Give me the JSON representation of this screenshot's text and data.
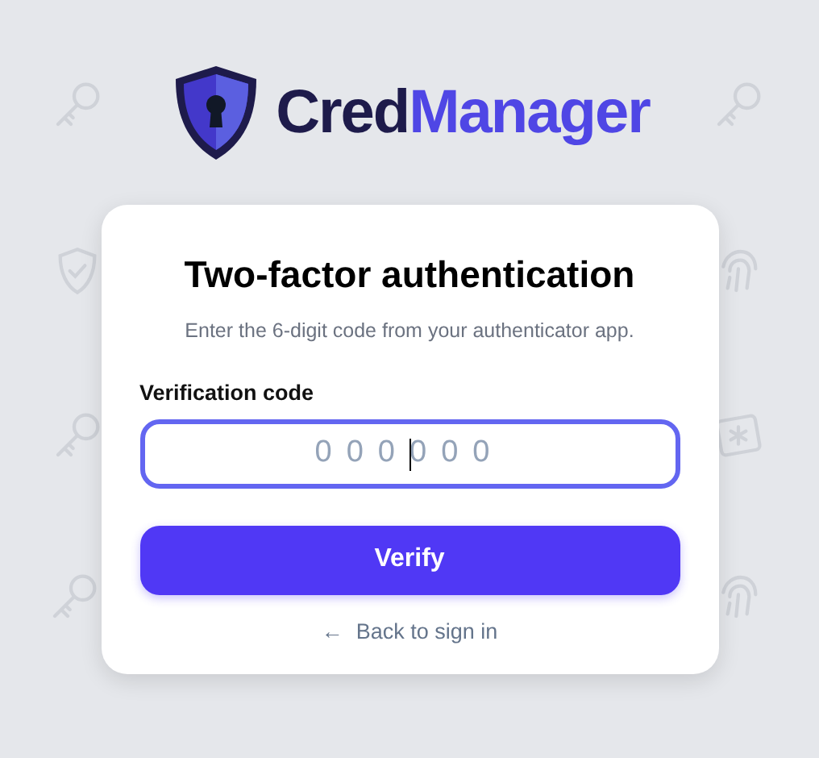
{
  "brand": {
    "name_part_1": "Cred",
    "name_part_2": "Manager"
  },
  "card": {
    "title": "Two-factor authentication",
    "subtitle": "Enter the 6-digit code from your authenticator app.",
    "field": {
      "label": "Verification code",
      "placeholder": "000000",
      "focused": true
    },
    "button": "Verify",
    "back_link": {
      "arrow": "←",
      "label": "Back to sign in"
    }
  }
}
